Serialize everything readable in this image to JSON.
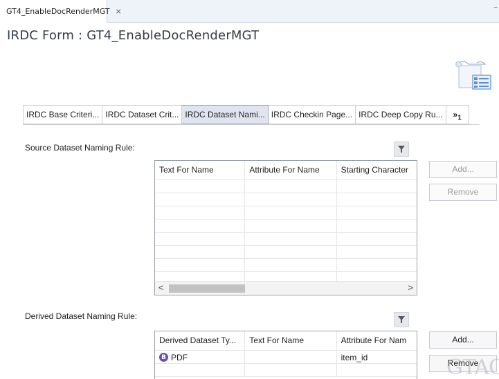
{
  "editor_tab": {
    "title": "GT4_EnableDocRenderMGT",
    "close_glyph": "⨯",
    "icon": "form-icon"
  },
  "minimize_glyph": "–",
  "form_title": "IRDC Form : GT4_EnableDocRenderMGT",
  "page_tabs": [
    {
      "label": "IRDC Base Criteri...",
      "active": false
    },
    {
      "label": "IRDC Dataset Crit...",
      "active": false
    },
    {
      "label": "IRDC Dataset Nami...",
      "active": true
    },
    {
      "label": "IRDC Checkin Page...",
      "active": false
    },
    {
      "label": "IRDC Deep Copy Ru...",
      "active": false
    }
  ],
  "more_tabs": {
    "label": "»",
    "count": "1"
  },
  "source_section": {
    "label": "Source Dataset Naming Rule:",
    "columns": [
      "Text For Name",
      "Attribute For Name",
      "Starting Character"
    ],
    "rows": [],
    "add_label": "Add...",
    "remove_label": "Remove",
    "scroll_left": "<",
    "scroll_right": ">"
  },
  "derived_section": {
    "label": "Derived Dataset Naming Rule:",
    "columns": [
      "Derived Dataset Ty...",
      "Text For Name",
      "Attribute For Nam"
    ],
    "rows": [
      {
        "type_badge": "B",
        "type": "PDF",
        "text_for_name": "",
        "attribute_for_name": "item_id"
      }
    ],
    "add_label": "Add...",
    "remove_label": "Remove"
  },
  "watermark": "GTAC",
  "colors": {
    "active_tab_bg": "#dfe4ee",
    "badge": "#6b4fb3",
    "tabbar_bg": "#eef3fa"
  }
}
